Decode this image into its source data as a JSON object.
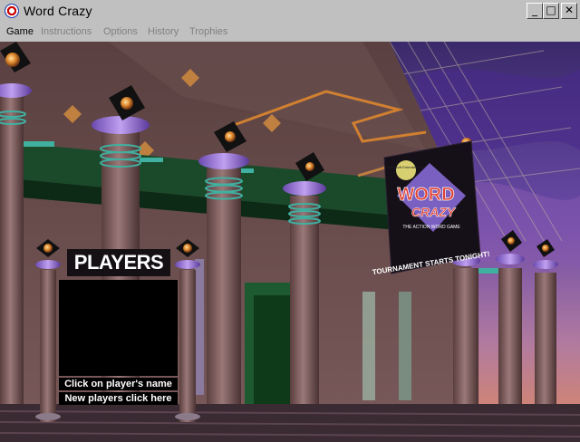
{
  "window": {
    "title": "Word Crazy",
    "buttons": {
      "minimize": "_",
      "maximize": "□",
      "close": "✕"
    }
  },
  "menu": {
    "items": [
      "Game",
      "Instructions",
      "Options",
      "History",
      "Trophies"
    ]
  },
  "banner": {
    "small_badge": "Microsoft Entertainment",
    "logo_line1": "WORD",
    "logo_line2": "CRAZY",
    "tagline": "THE ACTION WORD GAME",
    "caption": "TOURNAMENT STARTS TONIGHT!"
  },
  "players_panel": {
    "title": "PLAYERS",
    "hint_click_name": "Click on player's name",
    "hint_new_players": "New players click here"
  },
  "colors": {
    "sky_purple": "#5a3a9a",
    "column": "#8a6a6a",
    "ring_purple": "#9a7ad0",
    "teal": "#40b0a0"
  }
}
